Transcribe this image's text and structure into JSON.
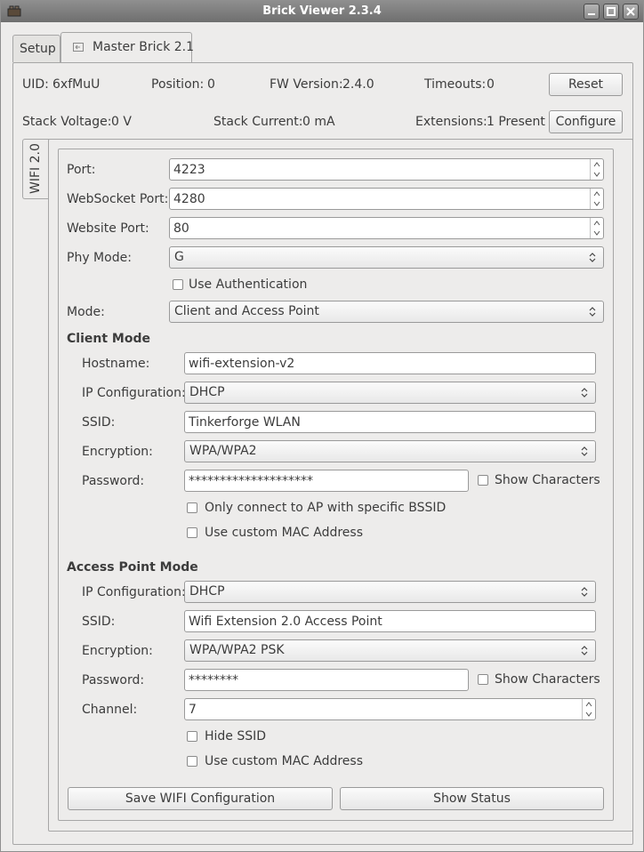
{
  "window": {
    "title": "Brick Viewer 2.3.4"
  },
  "tabs": {
    "setup": "Setup",
    "device": "Master Brick 2.1"
  },
  "info": {
    "uid_label": "UID:",
    "uid": "6xfMuU",
    "position_label": "Position:",
    "position": "0",
    "fw_label": "FW Version:",
    "fw": "2.4.0",
    "timeouts_label": "Timeouts:",
    "timeouts": "0",
    "reset": "Reset",
    "voltage_label": "Stack Voltage:",
    "voltage": "0 V",
    "current_label": "Stack Current:",
    "current": "0 mA",
    "extensions_label": "Extensions:",
    "extensions": "1 Present",
    "configure": "Configure"
  },
  "ext_tab": "WIFI 2.0",
  "wifi": {
    "port_label": "Port:",
    "port": "4223",
    "websocket_label": "WebSocket Port:",
    "websocket": "4280",
    "website_label": "Website Port:",
    "website": "80",
    "phy_label": "Phy Mode:",
    "phy": "G",
    "use_auth": "Use Authentication",
    "mode_label": "Mode:",
    "mode": "Client and Access Point"
  },
  "client": {
    "heading": "Client Mode",
    "hostname_label": "Hostname:",
    "hostname": "wifi-extension-v2",
    "ipconf_label": "IP Configuration:",
    "ipconf": "DHCP",
    "ssid_label": "SSID:",
    "ssid": "Tinkerforge WLAN",
    "enc_label": "Encryption:",
    "enc": "WPA/WPA2",
    "pw_label": "Password:",
    "pw": "********************",
    "show_chars": "Show Characters",
    "bssid": "Only connect to AP with specific BSSID",
    "mac": "Use custom MAC Address"
  },
  "ap": {
    "heading": "Access Point Mode",
    "ipconf_label": "IP Configuration:",
    "ipconf": "DHCP",
    "ssid_label": "SSID:",
    "ssid": "Wifi Extension 2.0 Access Point",
    "enc_label": "Encryption:",
    "enc": "WPA/WPA2 PSK",
    "pw_label": "Password:",
    "pw": "********",
    "show_chars": "Show Characters",
    "channel_label": "Channel:",
    "channel": "7",
    "hide_ssid": "Hide SSID",
    "mac": "Use custom MAC Address"
  },
  "actions": {
    "save": "Save WIFI Configuration",
    "status": "Show Status"
  },
  "icons": {
    "app": "brick-icon",
    "minimize": "minimize-icon",
    "maximize": "maximize-icon",
    "close": "close-icon",
    "undock": "undock-icon"
  }
}
